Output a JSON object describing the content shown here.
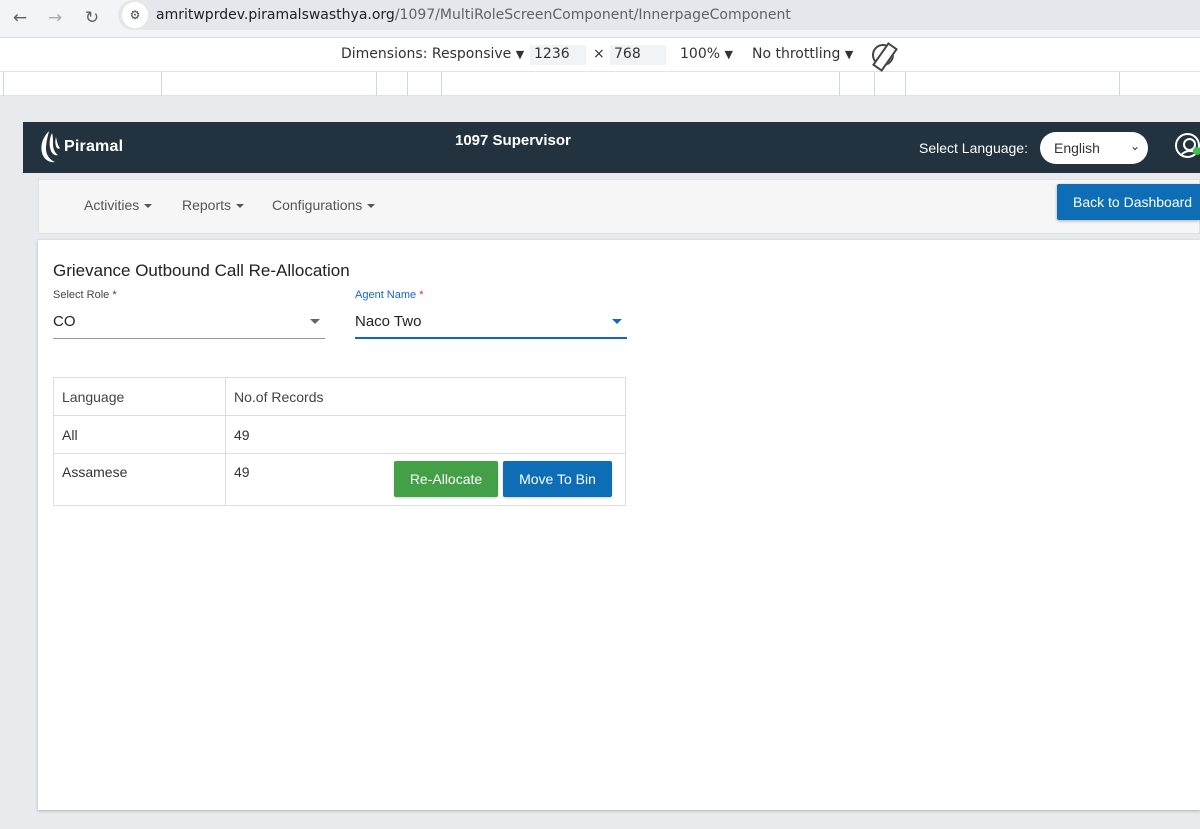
{
  "browser": {
    "url_host": "amritwprdev.piramalswasthya.org",
    "url_path": "/1097/MultiRoleScreenComponent/InnerpageComponent"
  },
  "devtools": {
    "dimensions_label": "Dimensions: Responsive",
    "width": "1236",
    "height": "768",
    "times": "×",
    "zoom": "100%",
    "throttling": "No throttling"
  },
  "header": {
    "logo_text": "Piramal",
    "title": "1097 Supervisor",
    "language_label": "Select Language:",
    "language_value": "English"
  },
  "menu": {
    "items": [
      {
        "label": "Activities"
      },
      {
        "label": "Reports"
      },
      {
        "label": "Configurations"
      }
    ],
    "back_button": "Back to Dashboard"
  },
  "page": {
    "title": "Grievance Outbound Call Re-Allocation",
    "role_field": {
      "label": "Select Role",
      "required": "*",
      "value": "CO"
    },
    "agent_field": {
      "label": "Agent Name",
      "required": "*",
      "value": "Naco Two"
    },
    "table": {
      "headers": [
        "Language",
        "No.of Records"
      ],
      "rows": [
        {
          "language": "All",
          "records": "49"
        },
        {
          "language": "Assamese",
          "records": "49"
        }
      ]
    },
    "reallocate_button": "Re-Allocate",
    "move_to_bin_button": "Move To Bin"
  },
  "colors": {
    "header_bg": "#22323f",
    "primary": "#0d6eb5",
    "success": "#43a047"
  }
}
